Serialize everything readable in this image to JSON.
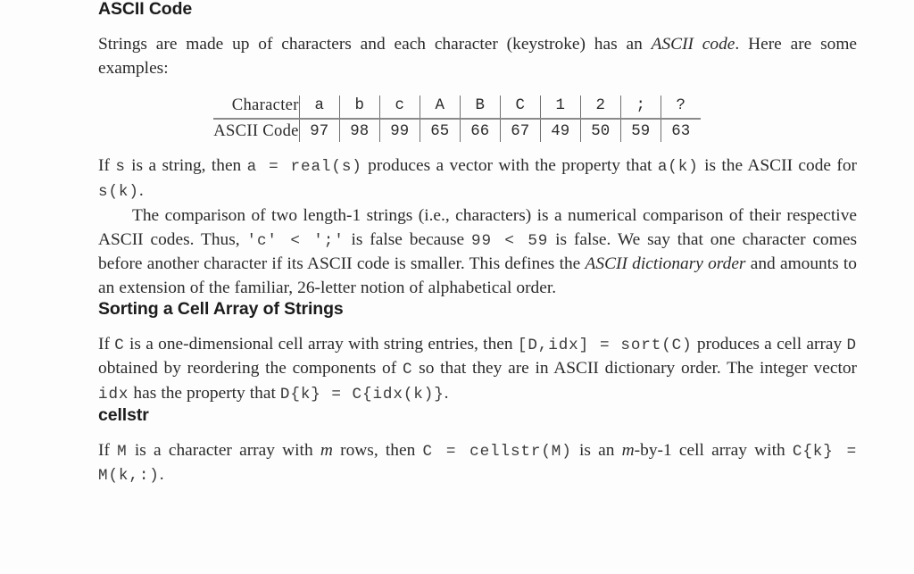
{
  "document": {
    "sections": [
      {
        "heading": "ASCII Code",
        "paragraphs": [
          {
            "id": "intro",
            "runs": [
              {
                "t": "Strings are made up of characters and each character (keystroke) has an ",
                "s": "normal"
              },
              {
                "t": "ASCII code",
                "s": "italic"
              },
              {
                "t": ". Here are some examples:",
                "s": "normal"
              }
            ]
          }
        ]
      },
      {
        "heading": "Sorting a Cell Array of Strings",
        "paragraphs": []
      },
      {
        "heading": "cellstr",
        "paragraphs": []
      }
    ]
  },
  "headings": {
    "ascii_code": "ASCII Code",
    "sorting_cell_array": "Sorting a Cell Array of Strings",
    "cellstr": "cellstr"
  },
  "paragraph_intro": {
    "part1": "Strings are made up of characters and each character (keystroke) has an ",
    "italic1": "ASCII code",
    "part2": ". Here are some examples:"
  },
  "ascii_table": {
    "row_labels": [
      "Character",
      "ASCII Code"
    ],
    "characters": [
      "a",
      "b",
      "c",
      "A",
      "B",
      "C",
      "1",
      "2",
      ";",
      "?"
    ],
    "codes": [
      "97",
      "98",
      "99",
      "65",
      "66",
      "67",
      "49",
      "50",
      "59",
      "63"
    ]
  },
  "paragraph_real": {
    "part1": "If ",
    "code1": "s",
    "part2": " is a string, then ",
    "code2": "a  =  real(s)",
    "part3": " produces a vector with the property that ",
    "code3": "a(k)",
    "part4": " is the ASCII code for ",
    "code4": "s(k)",
    "part5": "."
  },
  "paragraph_compare": {
    "part1": "The comparison of two length-1 strings (i.e., characters) is a numerical comparison of their respective ASCII codes. Thus, ",
    "code1": "'c'  <  ';'",
    "part2": " is false because ",
    "code2": "99  <  59",
    "part3": " is false. We say that one character comes before another character if its ASCII code is smaller. This defines the ",
    "italic1": "ASCII dictionary order",
    "part4": " and amounts to an extension of the familiar, 26-letter notion of alphabetical order."
  },
  "paragraph_sort": {
    "part1": "If ",
    "code1": "C",
    "part2": " is a one-dimensional cell array with string entries, then ",
    "code2": "[D,idx]  =  sort(C)",
    "part3": " produces a cell array ",
    "code3": "D",
    "part4": " obtained by reordering the components of ",
    "code4": "C",
    "part5": " so that they are in ASCII dictionary order. The integer vector ",
    "code5": "idx",
    "part6": " has the property that ",
    "code6": "D{k}  =  C{idx(k)}",
    "part7": "."
  },
  "paragraph_cellstr": {
    "part1": "If ",
    "code1": "M",
    "part2": " is a character array with ",
    "italic1": "m",
    "part3": " rows, then ",
    "code2": "C  =  cellstr(M)",
    "part4": " is an ",
    "italic2": "m",
    "part5": "-by-1 cell array with ",
    "code3": "C{k}  =  M(k,:)",
    "part6": "."
  },
  "colors": {
    "page_background": "#fdfdfd",
    "body_text": "#2b2b2b",
    "heading_text": "#1c1c1c",
    "code_text": "#3a3a3a",
    "table_rule": "#8a8a8a",
    "table_divider": "#6f6f6f"
  }
}
